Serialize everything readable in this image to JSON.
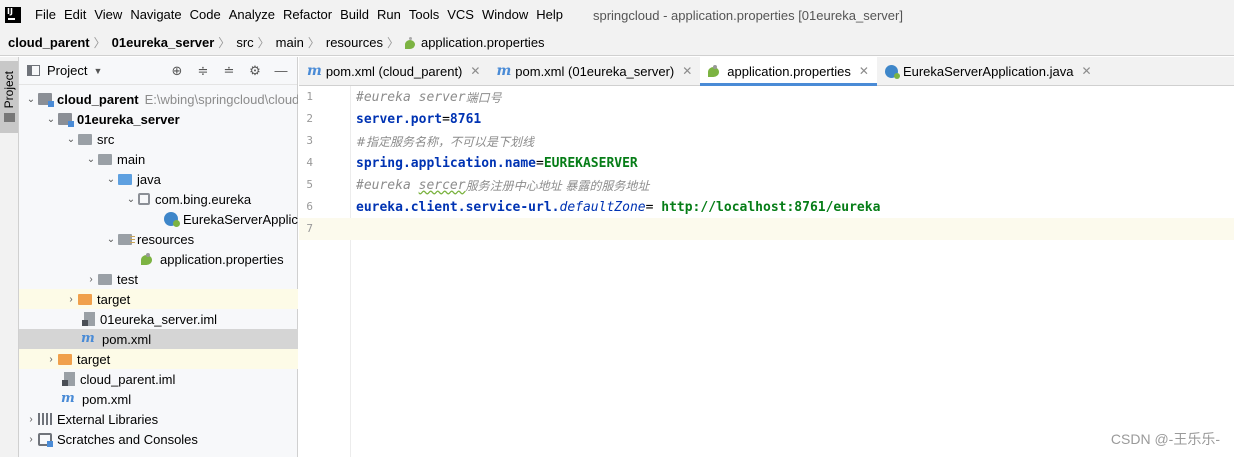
{
  "menubar": {
    "items": [
      "File",
      "Edit",
      "View",
      "Navigate",
      "Code",
      "Analyze",
      "Refactor",
      "Build",
      "Run",
      "Tools",
      "VCS",
      "Window",
      "Help"
    ],
    "window_title": "springcloud - application.properties [01eureka_server]"
  },
  "breadcrumbs": [
    "cloud_parent",
    "01eureka_server",
    "src",
    "main",
    "resources",
    "application.properties"
  ],
  "left_stripe": {
    "tab_label": "Project"
  },
  "project_panel": {
    "title": "Project",
    "tree": [
      {
        "label": "cloud_parent",
        "path": "E:\\wbing\\springcloud\\cloud_parent",
        "bold": true
      },
      {
        "label": "01eureka_server",
        "bold": true
      },
      {
        "label": "src"
      },
      {
        "label": "main"
      },
      {
        "label": "java"
      },
      {
        "label": "com.bing.eureka"
      },
      {
        "label": "EurekaServerApplication"
      },
      {
        "label": "resources"
      },
      {
        "label": "application.properties"
      },
      {
        "label": "test"
      },
      {
        "label": "target"
      },
      {
        "label": "01eureka_server.iml"
      },
      {
        "label": "pom.xml"
      },
      {
        "label": "target"
      },
      {
        "label": "cloud_parent.iml"
      },
      {
        "label": "pom.xml"
      },
      {
        "label": "External Libraries"
      },
      {
        "label": "Scratches and Consoles"
      }
    ]
  },
  "tabs": [
    {
      "label": "pom.xml (cloud_parent)",
      "icon": "maven-icon"
    },
    {
      "label": "pom.xml (01eureka_server)",
      "icon": "maven-icon"
    },
    {
      "label": "application.properties",
      "icon": "spring-leaf-icon",
      "active": true
    },
    {
      "label": "EurekaServerApplication.java",
      "icon": "spring-class-icon"
    }
  ],
  "editor": {
    "line_numbers": [
      "1",
      "2",
      "3",
      "4",
      "5",
      "6",
      "7"
    ],
    "current_line": 7,
    "lines": {
      "l1_comment": "#eureka server",
      "l1_cjk": "端口号",
      "l2_key": "server.port",
      "l2_eq": "=",
      "l2_val": "8761",
      "l3_comment": "#指定服务名称，不可以是下划线",
      "l4_key": "spring.application.name",
      "l4_eq": "=",
      "l4_val": "EUREKASERVER",
      "l5_comment": "#eureka ",
      "l5_typo": "sercer",
      "l5_cjk": "服务注册中心地址 暴露的服务地址",
      "l6_key": "eureka.client.service-url.",
      "l6_keyi": "defaultZone",
      "l6_eq": "= ",
      "l6_val": "http://localhost:8761/eureka"
    }
  },
  "watermark": "CSDN @-王乐乐-",
  "colors": {
    "accent": "#4a8bd6",
    "key": "#0033b3",
    "value": "#067d17",
    "comment": "#8c8c8c",
    "current_line": "#fcfaed"
  }
}
